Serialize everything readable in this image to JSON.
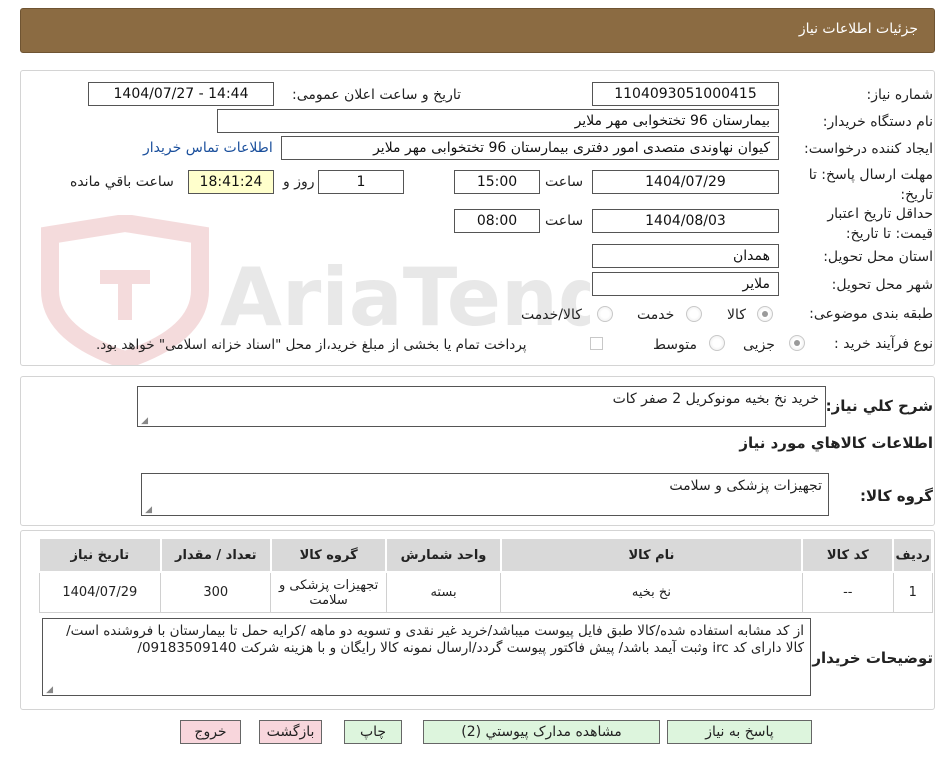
{
  "header": {
    "title": "جزئیات اطلاعات نیاز"
  },
  "form": {
    "need_number": {
      "label": "شماره نیاز:",
      "value": "1104093051000415"
    },
    "announce_datetime": {
      "label": "تاریخ و ساعت اعلان عمومی:",
      "value": "1404/07/27 - 14:44"
    },
    "buyer_org": {
      "label": "نام دستگاه خریدار:",
      "value": "بیمارستان 96 تختخوابی مهر ملایر"
    },
    "requester": {
      "label": "ایجاد کننده درخواست:",
      "value": "کیوان نهاوندی متصدی امور دفتری بیمارستان 96 تختخوابی مهر ملایر",
      "contact_link": "اطلاعات تماس خریدار"
    },
    "reply_deadline": {
      "label": "مهلت ارسال پاسخ: تا تاریخ:",
      "date": "1404/07/29",
      "time_label": "ساعت",
      "time": "15:00",
      "days": "1",
      "days_label": "روز و",
      "remaining": "18:41:24",
      "remaining_label": "ساعت باقي مانده"
    },
    "price_validity": {
      "label": "حداقل تاریخ اعتبار قیمت: تا تاریخ:",
      "date": "1404/08/03",
      "time_label": "ساعت",
      "time": "08:00"
    },
    "province": {
      "label": "استان محل تحویل:",
      "value": "همدان"
    },
    "city": {
      "label": "شهر محل تحویل:",
      "value": "ملایر"
    },
    "category": {
      "label": "طبقه بندی موضوعی:",
      "options": [
        "کالا",
        "خدمت",
        "کالا/خدمت"
      ],
      "selected": "کالا"
    },
    "purchase_process": {
      "label": "نوع فرآیند خرید :",
      "options": [
        "جزیی",
        "متوسط"
      ],
      "selected": "جزیی",
      "checkbox_text": "پرداخت تمام یا بخشی از مبلغ خرید،از محل \"اسناد خزانه اسلامی\" خواهد بود."
    }
  },
  "watermark": {
    "text": "AriaTender.neT"
  },
  "summary": {
    "label": "شرح کلي نياز:",
    "value": "خرید نخ بخیه مونوکریل   2 صفر کات"
  },
  "goods_section": {
    "title": "اطلاعات کالاهاي مورد نياز"
  },
  "goods_group": {
    "label": "گروه کالا:",
    "value": "تجهیزات پزشکی و سلامت"
  },
  "table": {
    "headers": {
      "row": "رديف",
      "code": "کد کالا",
      "name": "نام کالا",
      "unit": "واحد شمارش",
      "group": "گروه کالا",
      "qty": "تعداد / مقدار",
      "date": "تاريخ نياز"
    },
    "rows": [
      {
        "row": "1",
        "code": "--",
        "name": "نخ بخیه",
        "unit": "بسته",
        "group": "تجهیزات پزشکی و سلامت",
        "qty": "300",
        "date": "1404/07/29"
      }
    ]
  },
  "buyer_notes": {
    "label": "توضيحات خريدار:",
    "value": "از کد مشابه استفاده شده/کالا طبق فایل پیوست  میباشد/خرید غیر نقدی و تسویه دو ماهه  /کرایه حمل تا بیمارستان با فروشنده است/کالا دارای کد irc  وثبت آیمد باشد/ پیش فاکتور پیوست گردد/ارسال نمونه کالا رایگان و با هزینه شرکت 09183509140/"
  },
  "buttons": {
    "reply": "پاسخ به نیاز",
    "attachments": "مشاهده مدارک پیوستي (2)",
    "print": "چاپ",
    "back": "بازگشت",
    "exit": "خروج"
  },
  "colors": {
    "header_bg": "#8b6b42",
    "highlight_bg": "#ffffcc",
    "link": "#1a4f9c",
    "green_button": "#ddf5dd",
    "pink_button": "#f8d6dc"
  }
}
